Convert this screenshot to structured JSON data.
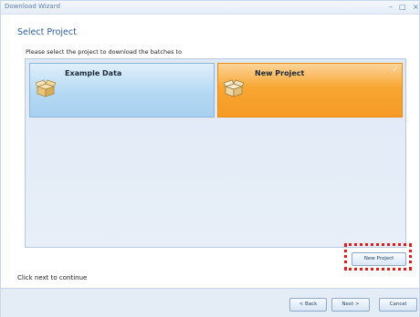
{
  "window": {
    "title": "Download Wizard",
    "controls": {
      "minimize": "–",
      "maximize": "□",
      "close": "×"
    }
  },
  "page": {
    "heading": "Select Project",
    "instruction": "Please select the project to download the batches to",
    "footer_hint": "Click next to continue"
  },
  "projects": [
    {
      "name": "Example Data",
      "selected": false,
      "icon": "box-icon"
    },
    {
      "name": "New Project",
      "selected": true,
      "icon": "box-icon"
    }
  ],
  "buttons": {
    "new_project": "New Project",
    "back": "< Back",
    "next": "Next >",
    "cancel": "Cancel"
  },
  "colors": {
    "tile_default": "#b4d9f3",
    "tile_selected": "#f8a632",
    "highlight": "#e01d1d",
    "heading": "#2f5e9a"
  }
}
